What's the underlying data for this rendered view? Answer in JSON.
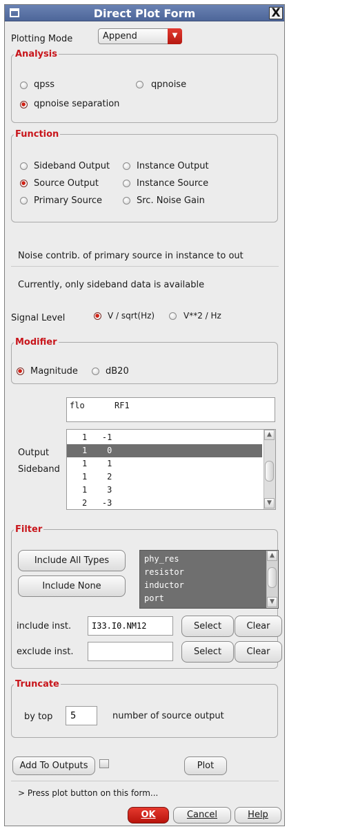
{
  "window": {
    "title": "Direct Plot Form",
    "close_glyph": "X"
  },
  "plotting_mode": {
    "label": "Plotting Mode",
    "value": "Append"
  },
  "analysis": {
    "title": "Analysis",
    "options": [
      {
        "label": "qpss",
        "selected": false
      },
      {
        "label": "qpnoise",
        "selected": false
      },
      {
        "label": "qpnoise separation",
        "selected": true
      }
    ]
  },
  "function": {
    "title": "Function",
    "options": [
      {
        "label": "Sideband Output",
        "selected": false
      },
      {
        "label": "Instance Output",
        "selected": false
      },
      {
        "label": "Source Output",
        "selected": true
      },
      {
        "label": "Instance Source",
        "selected": false
      },
      {
        "label": "Primary Source",
        "selected": false
      },
      {
        "label": "Src. Noise Gain",
        "selected": false
      }
    ]
  },
  "description": "Noise contrib. of primary source in instance to out",
  "availability_note": "Currently, only sideband data is available",
  "signal_level": {
    "label": "Signal Level",
    "options": [
      {
        "label": "V / sqrt(Hz)",
        "selected": true
      },
      {
        "label": "V**2 / Hz",
        "selected": false
      }
    ]
  },
  "modifier": {
    "title": "Modifier",
    "options": [
      {
        "label": "Magnitude",
        "selected": true
      },
      {
        "label": "dB20",
        "selected": false
      }
    ]
  },
  "output_sideband": {
    "label_line1": "Output",
    "label_line2": "Sideband",
    "header": "flo      RF1",
    "rows": [
      {
        "text": "1   -1",
        "selected": false
      },
      {
        "text": "1    0",
        "selected": true
      },
      {
        "text": "1    1",
        "selected": false
      },
      {
        "text": "1    2",
        "selected": false
      },
      {
        "text": "1    3",
        "selected": false
      },
      {
        "text": "2   -3",
        "selected": false
      }
    ]
  },
  "filter": {
    "title": "Filter",
    "include_all_label": "Include All Types",
    "include_none_label": "Include None",
    "types": [
      "phy_res",
      "resistor",
      "inductor",
      "port"
    ],
    "include_inst_label": "include inst.",
    "include_inst_value": "I33.I0.NM12",
    "exclude_inst_label": "exclude inst.",
    "exclude_inst_value": "",
    "select_label": "Select",
    "clear_label": "Clear"
  },
  "truncate": {
    "title": "Truncate",
    "by_top_label": "by top",
    "value": "5",
    "suffix": "number of source output"
  },
  "actions": {
    "add_to_outputs": "Add To Outputs",
    "plot": "Plot",
    "status": "> Press plot button on this form...",
    "ok": "OK",
    "cancel": "Cancel",
    "help": "Help"
  },
  "colors": {
    "accent": "#c8151b",
    "titlebar": "#5a72a6",
    "ok_button": "#c8151b"
  }
}
